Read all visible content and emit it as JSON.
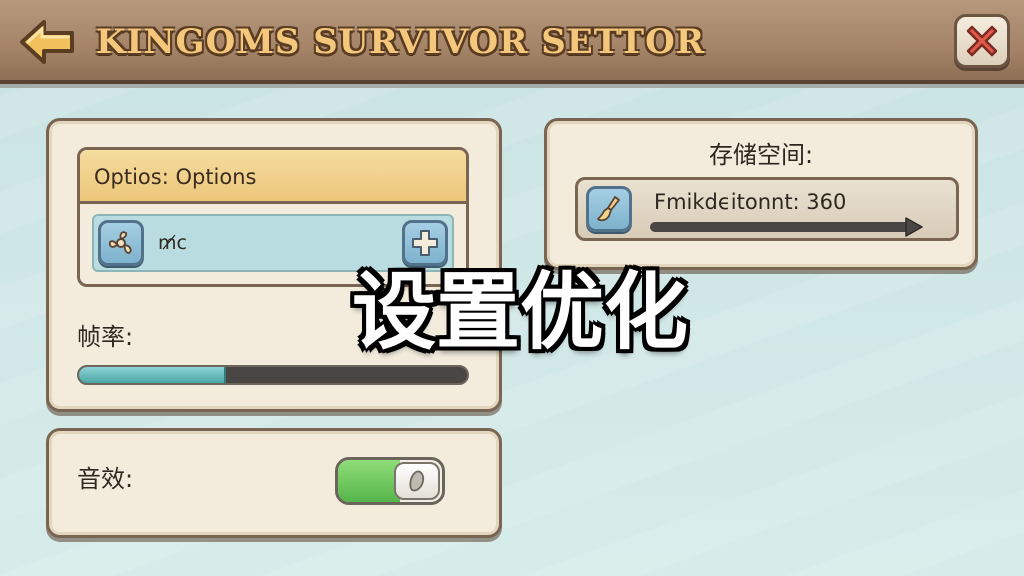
{
  "header": {
    "title": "Kingoms survivor settor",
    "back_icon": "arrow-left-icon",
    "close_icon": "close-x-icon"
  },
  "options_panel": {
    "header": "Optios: Options",
    "value": "m̸c",
    "left_icon": "fan-icon",
    "right_icon": "plus-icon"
  },
  "fps": {
    "label": "帧率:",
    "level": 0.38
  },
  "sound": {
    "label": "音效:",
    "enabled": true
  },
  "storage": {
    "title": "存储空间:",
    "text": "Fmikdϵitonnt: 360",
    "icon": "broom-icon"
  },
  "overlay": {
    "caption": "设置优化"
  },
  "colors": {
    "header_wood": "#a58468",
    "title_text": "#f4c77c",
    "panel_bg": "#f3ecdd",
    "accent_yellow": "#ecc77a",
    "toggle_green": "#56b54a",
    "bar_teal": "#4aa7a5",
    "close_red": "#e05a4a"
  }
}
